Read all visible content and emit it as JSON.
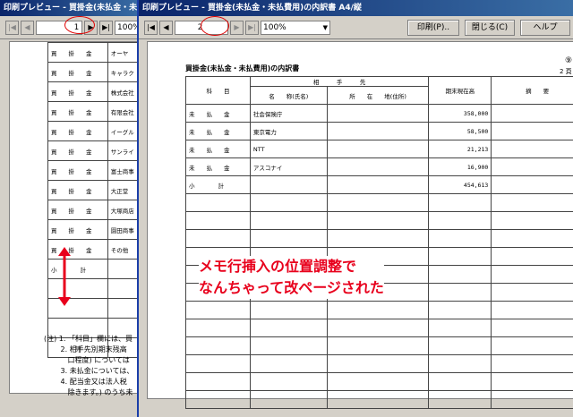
{
  "back_window": {
    "title": "印刷プレビュー - 買掛金(未払金・未払費",
    "page_number": "1",
    "zoom": "100%",
    "rows": [
      {
        "kamoku": "買　　掛　　金",
        "name": "オーヤ"
      },
      {
        "kamoku": "買　　掛　　金",
        "name": "キャラク"
      },
      {
        "kamoku": "買　　掛　　金",
        "name": "株式会社"
      },
      {
        "kamoku": "買　　掛　　金",
        "name": "有限会社"
      },
      {
        "kamoku": "買　　掛　　金",
        "name": "イーグル"
      },
      {
        "kamoku": "買　　掛　　金",
        "name": "サンライ"
      },
      {
        "kamoku": "買　　掛　　金",
        "name": "富士商事"
      },
      {
        "kamoku": "買　　掛　　金",
        "name": "大正堂"
      },
      {
        "kamoku": "買　　掛　　金",
        "name": "大塚商店"
      },
      {
        "kamoku": "買　　掛　　金",
        "name": "園田商事"
      },
      {
        "kamoku": "買　　掛　　金",
        "name": "その他"
      },
      {
        "kamoku": "小　　　　計",
        "name": ""
      }
    ],
    "total_label": "計",
    "notes": [
      "(注) 1. 「科目」欄には、買",
      "　　 2. 相手先別期末残高",
      "　　　 口程度) については",
      "　　 3. 未払金については、",
      "　　 4. 配当金又は法人税",
      "　　　 除きます。) のうち未"
    ]
  },
  "front_window": {
    "title": "印刷プレビュー - 買掛金(未払金・未払費用)の内訳書 A4/縦",
    "page_number": "2",
    "zoom": "100%",
    "buttons": {
      "print": "印刷(P)..",
      "close": "閉じる(C)",
      "help": "ヘルプ"
    },
    "doc_title": "買掛金(未払金・未払費用)の内訳書",
    "form_number": "⑨",
    "page_marker": "2 頁",
    "headers": {
      "kamoku": "科　　目",
      "aite": "相　　　手　　　先",
      "name": "名　　称(氏名)",
      "address": "所　　在　　地(住所)",
      "balance": "期末現在高",
      "remarks": "摘　　要"
    },
    "rows": [
      {
        "kamoku": "未　　払　　金",
        "name": "社会保険庁",
        "balance": "358,000"
      },
      {
        "kamoku": "未　　払　　金",
        "name": "東京電力",
        "balance": "58,500"
      },
      {
        "kamoku": "未　　払　　金",
        "name": "NTT",
        "balance": "21,213"
      },
      {
        "kamoku": "未　　払　　金",
        "name": "アスコナイ",
        "balance": "16,900"
      },
      {
        "kamoku": "小　　　　計",
        "name": "",
        "balance": "454,613"
      }
    ],
    "annotation": [
      "メモ行挿入の位置調整で",
      "なんちゃって改ページされた"
    ]
  }
}
